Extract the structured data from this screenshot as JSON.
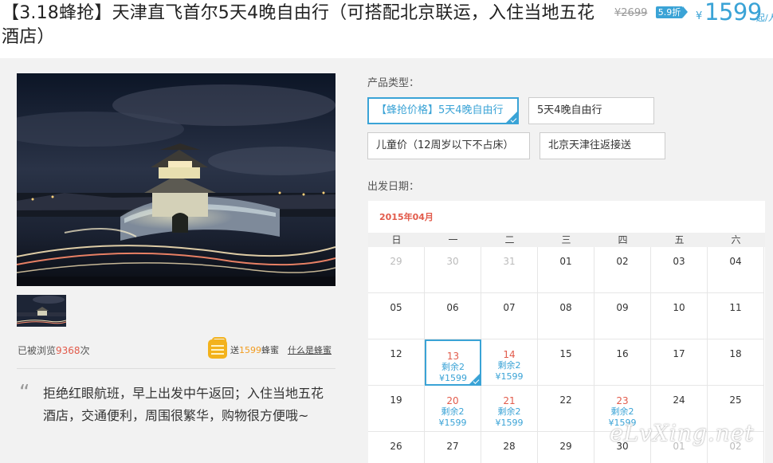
{
  "header": {
    "title": "【3.18蜂抢】天津直飞首尔5天4晚自由行（可搭配北京联运，入住当地五花酒店）",
    "original_price": "¥2699",
    "discount": "5.9折",
    "currency": "¥",
    "price": "1599",
    "price_suffix": "起/人"
  },
  "gallery": {
    "main_image": "night-photo-of-illuminated-korean-fortress-gate",
    "thumbnails": [
      "night-photo-of-illuminated-korean-fortress-gate"
    ]
  },
  "stats": {
    "views_prefix": "已被浏览",
    "views_count": "9368",
    "views_suffix": "次",
    "honey_prefix": "送",
    "honey_count": "1599",
    "honey_suffix": "蜂蜜",
    "honey_link": "什么是蜂蜜"
  },
  "description": {
    "quote_mark": "“",
    "text": "拒绝红眼航班，早上出发中午返回；入住当地五花酒店，交通便利，周围很繁华，购物很方便哦~"
  },
  "product_type": {
    "label": "产品类型：",
    "options": [
      {
        "label": "【蜂抢价格】5天4晚自由行",
        "selected": true
      },
      {
        "label": "5天4晚自由行",
        "selected": false
      },
      {
        "label": "儿童价（12周岁以下不占床）",
        "selected": false
      },
      {
        "label": "北京天津往返接送",
        "selected": false
      }
    ]
  },
  "calendar": {
    "label": "出发日期：",
    "month": "2015年04月",
    "weekdays": [
      "日",
      "一",
      "二",
      "三",
      "四",
      "五",
      "六"
    ],
    "weeks": [
      [
        {
          "d": "29",
          "o": true
        },
        {
          "d": "30",
          "o": true
        },
        {
          "d": "31",
          "o": true
        },
        {
          "d": "01"
        },
        {
          "d": "02"
        },
        {
          "d": "03"
        },
        {
          "d": "04"
        }
      ],
      [
        {
          "d": "05"
        },
        {
          "d": "06"
        },
        {
          "d": "07"
        },
        {
          "d": "08"
        },
        {
          "d": "09"
        },
        {
          "d": "10"
        },
        {
          "d": "11"
        }
      ],
      [
        {
          "d": "12"
        },
        {
          "d": "13",
          "stock": "剩余2",
          "price": "¥1599",
          "sel": true
        },
        {
          "d": "14",
          "stock": "剩余2",
          "price": "¥1599"
        },
        {
          "d": "15"
        },
        {
          "d": "16"
        },
        {
          "d": "17"
        },
        {
          "d": "18"
        }
      ],
      [
        {
          "d": "19"
        },
        {
          "d": "20",
          "stock": "剩余2",
          "price": "¥1599"
        },
        {
          "d": "21",
          "stock": "剩余2",
          "price": "¥1599"
        },
        {
          "d": "22"
        },
        {
          "d": "23",
          "stock": "剩余2",
          "price": "¥1599"
        },
        {
          "d": "24"
        },
        {
          "d": "25"
        }
      ],
      [
        {
          "d": "26"
        },
        {
          "d": "27"
        },
        {
          "d": "28"
        },
        {
          "d": "29"
        },
        {
          "d": "30"
        },
        {
          "d": "01",
          "o": true
        },
        {
          "d": "02",
          "o": true
        }
      ]
    ]
  },
  "watermark": "eLvXing.net",
  "colors": {
    "accent": "#3aa3d6",
    "red": "#e25b4b",
    "honey": "#f29c1f"
  }
}
